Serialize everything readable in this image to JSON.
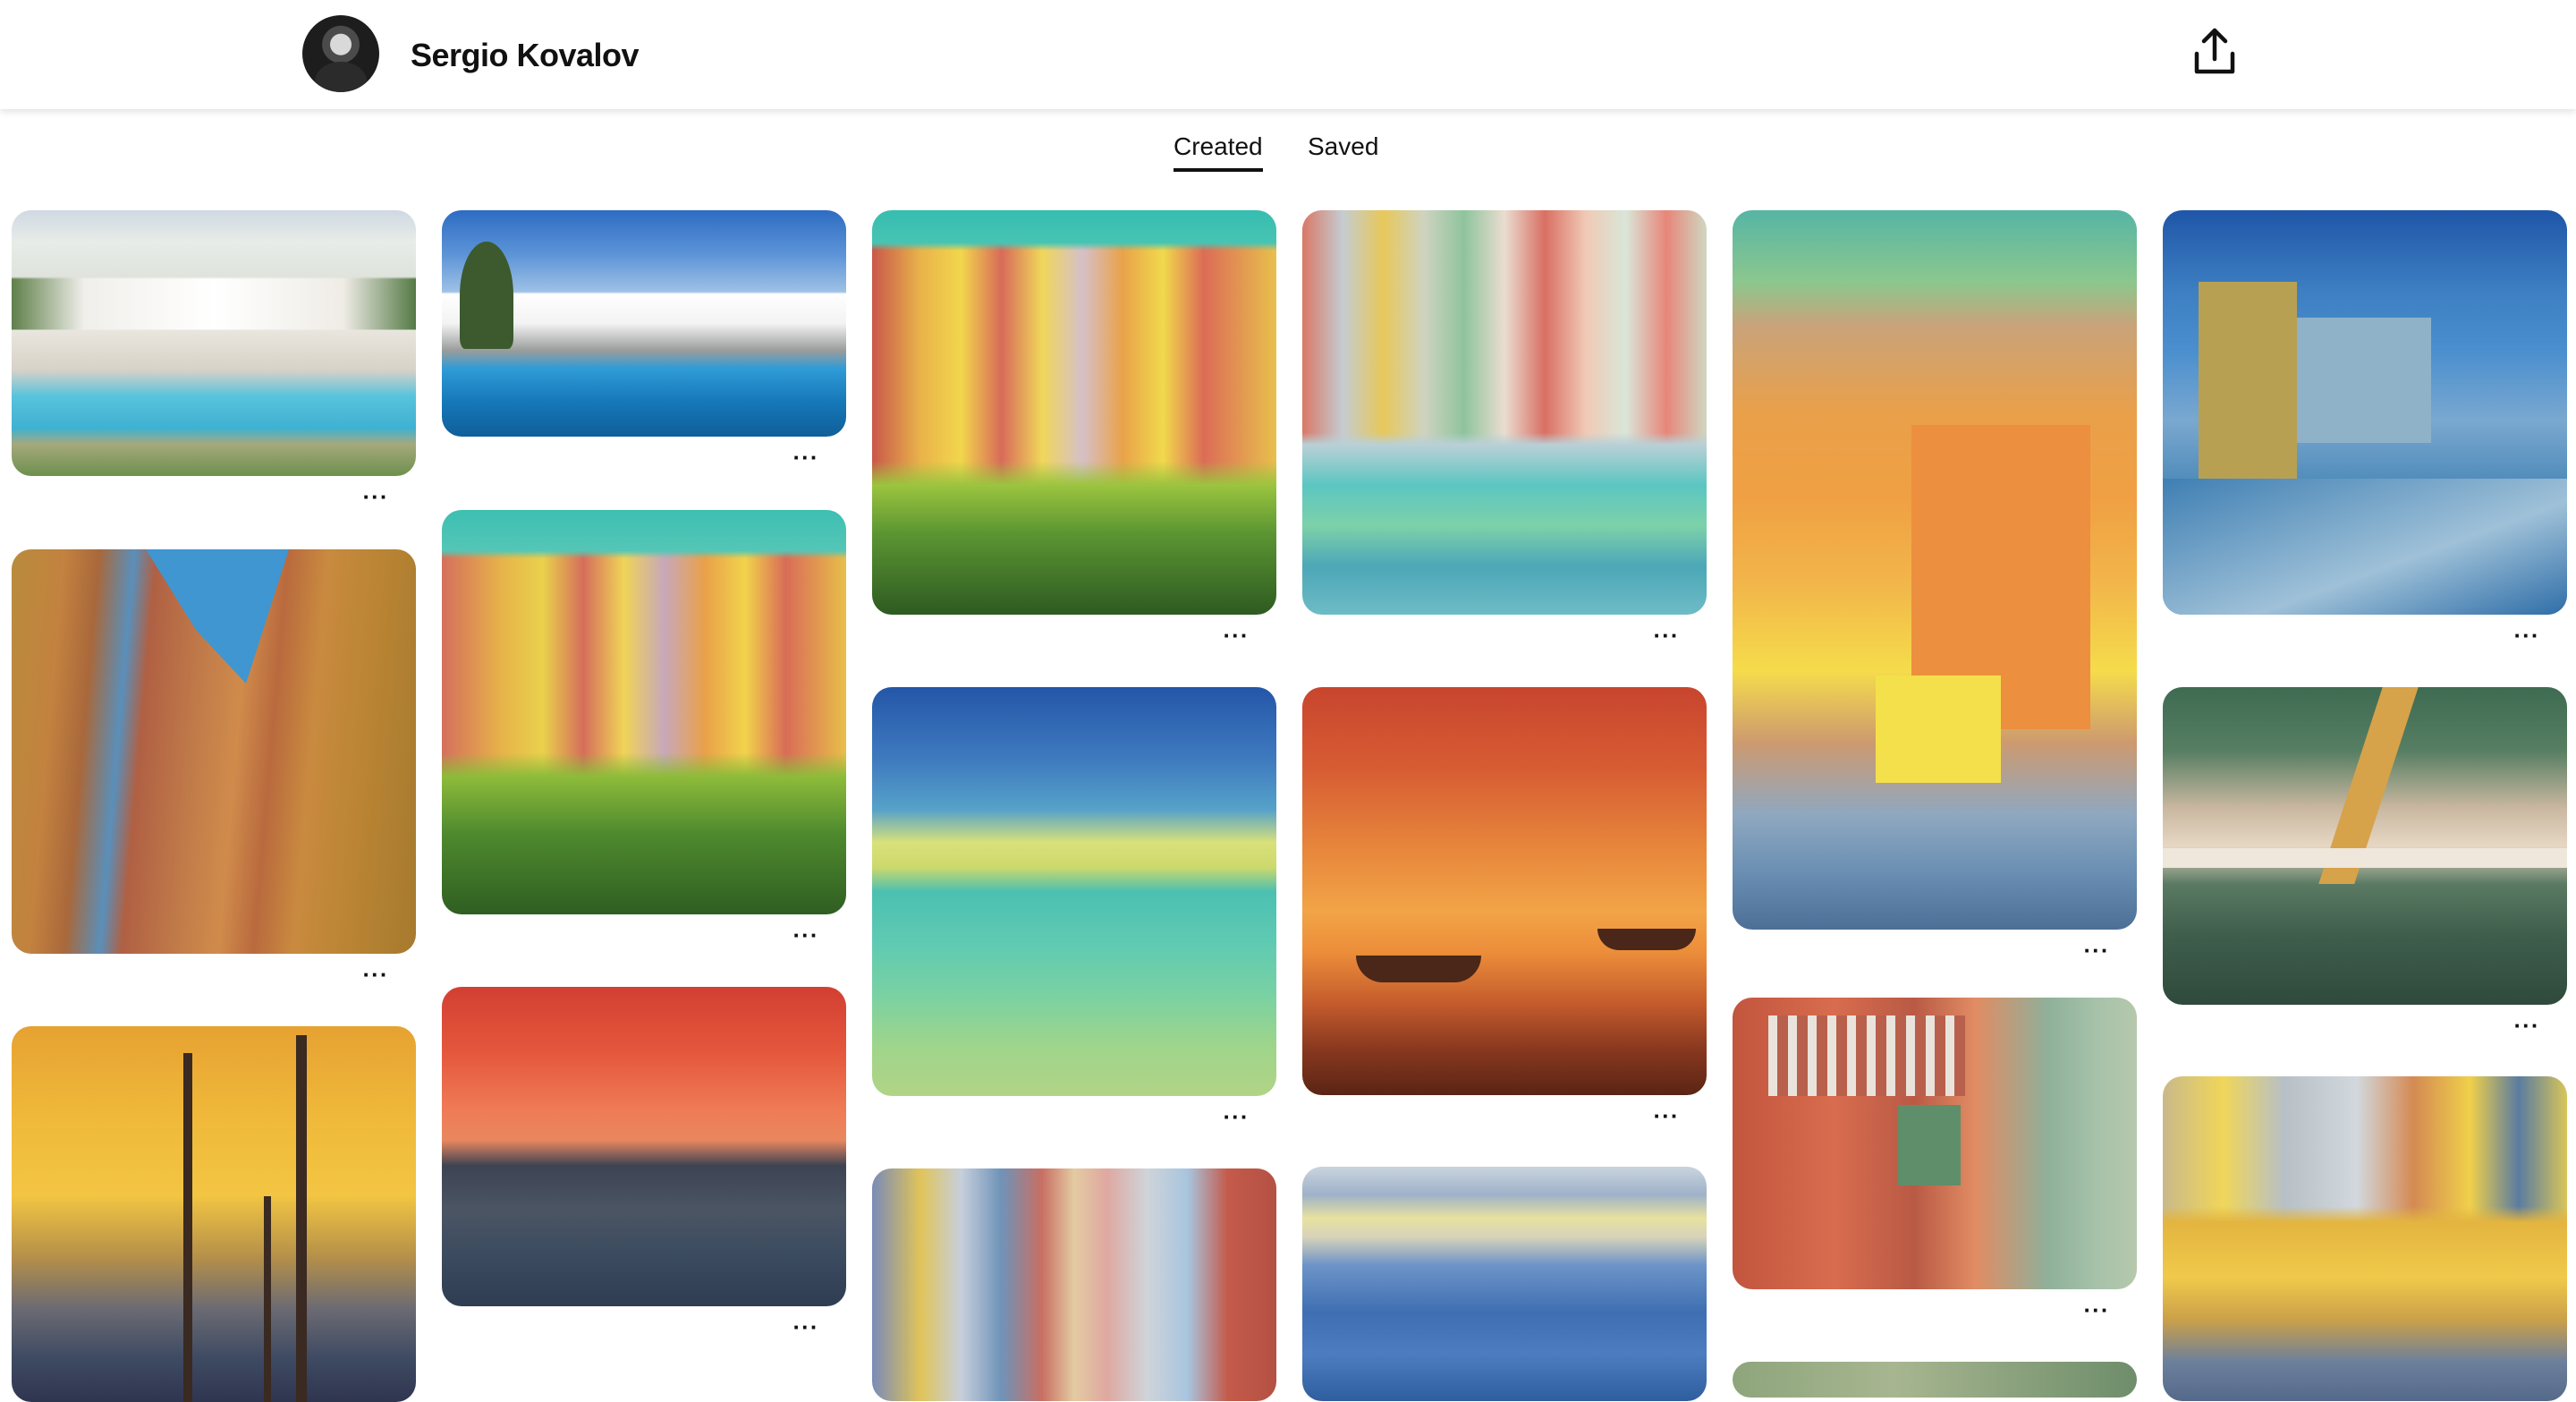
{
  "header": {
    "profile_name": "Sergio Kovalov",
    "avatar_icon": "avatar-photo",
    "share_icon": "share-upload-icon"
  },
  "tabs": [
    {
      "label": "Created",
      "active": true
    },
    {
      "label": "Saved",
      "active": false
    }
  ],
  "grid": {
    "more_label": "···",
    "pins": [
      {
        "subject": "modern villa with pool",
        "more": true
      },
      {
        "subject": "modern villa over pool",
        "more": true
      },
      {
        "subject": "colorful hillside town painting",
        "more": true
      },
      {
        "subject": "harbor houses with boats painting",
        "more": true
      },
      {
        "subject": "orange houses painting",
        "more": true
      },
      {
        "subject": "blue building painting",
        "more": true
      },
      {
        "subject": "canyon walls painting",
        "more": true
      },
      {
        "subject": "hillside town painting",
        "more": true
      },
      {
        "subject": "turquoise sea painting",
        "more": true
      },
      {
        "subject": "orange sunset boats painting",
        "more": true
      },
      {
        "subject": "pergola shadows painting",
        "more": true
      },
      {
        "subject": "pergola structure painting",
        "more": true
      },
      {
        "subject": "sunset masts painting",
        "more": false
      },
      {
        "subject": "red sky landscape painting",
        "more": true
      },
      {
        "subject": "narrow street painting",
        "more": false
      },
      {
        "subject": "harbor town painting",
        "more": false
      },
      {
        "subject": "yellow houses painting",
        "more": false
      }
    ]
  }
}
